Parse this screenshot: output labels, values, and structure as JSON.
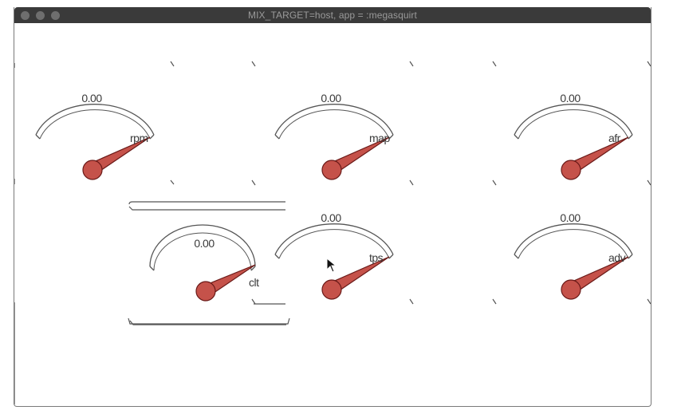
{
  "window": {
    "title": "MIX_TARGET=host, app = :megasquirt"
  },
  "colors": {
    "needle": "#c5524a",
    "needle_edge": "#6a1a18",
    "titlebar": "#3a3a3a"
  },
  "gauges": [
    {
      "value": "0.00",
      "label": "rpm"
    },
    {
      "value": "0.00",
      "label": "map"
    },
    {
      "value": "0.00",
      "label": "afr"
    },
    {
      "value": "0.00",
      "label": "tps"
    },
    {
      "value": "0.00",
      "label": "adv"
    },
    {
      "value": "0.00",
      "label": "clt"
    }
  ]
}
